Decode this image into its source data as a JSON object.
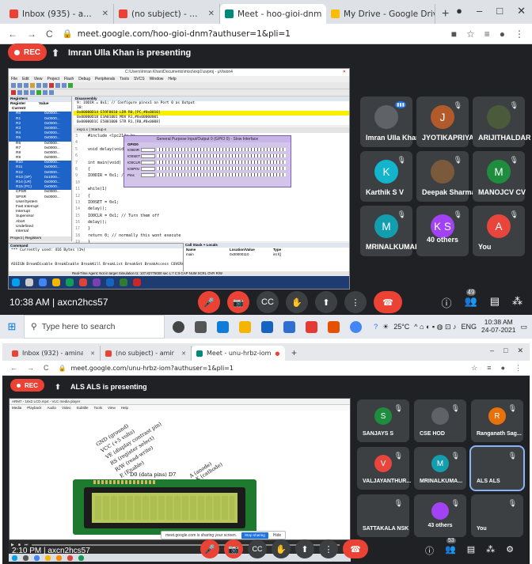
{
  "shot1": {
    "tabs": [
      {
        "label": "Inbox (935) - aminacs.skitbr@gm",
        "color": "#ea4335",
        "glyph": "M"
      },
      {
        "label": "(no subject) - aminacse@skit.org",
        "color": "#ea4335",
        "glyph": "M"
      },
      {
        "label": "Meet - hoo-gioi-dnm",
        "color": "#00897b",
        "glyph": "▶",
        "active": true
      },
      {
        "label": "My Drive - Google Drive",
        "color": "#fbbc04",
        "glyph": "▲"
      }
    ],
    "url": "meet.google.com/hoo-gioi-dnm?authuser=1&pli=1",
    "rec_label": "REC",
    "presenting_text": "Imran Ulla Khan is presenting",
    "ide": {
      "title": "C:\\Users\\Imran Khan\\Documents\\misc\\exp1\\uvproj - μVision4",
      "menu": [
        "File",
        "Edit",
        "View",
        "Project",
        "Flash",
        "Debug",
        "Peripherals",
        "Tools",
        "SVCS",
        "Window",
        "Help"
      ],
      "reg_header": "Registers",
      "reg_cols": [
        "Register",
        "Value"
      ],
      "reg_current": "Current",
      "registers": [
        {
          "name": "R0",
          "value": "0x0000..."
        },
        {
          "name": "R1",
          "value": "0x0000..."
        },
        {
          "name": "R2",
          "value": "0x0000..."
        },
        {
          "name": "R3",
          "value": "0x0000..."
        },
        {
          "name": "R4",
          "value": "0x0000..."
        },
        {
          "name": "R5",
          "value": "0x0000..."
        },
        {
          "name": "R6",
          "value": "0x0000..."
        },
        {
          "name": "R7",
          "value": "0x0000..."
        },
        {
          "name": "R8",
          "value": "0x0000..."
        },
        {
          "name": "R9",
          "value": "0x0000..."
        },
        {
          "name": "R10",
          "value": "0x0000..."
        },
        {
          "name": "R11",
          "value": "0x0000..."
        },
        {
          "name": "R12",
          "value": "0x0000..."
        },
        {
          "name": "R13 (SP)",
          "value": "0x1000..."
        },
        {
          "name": "R14 (LR)",
          "value": "0x0000..."
        },
        {
          "name": "R15 (PC)",
          "value": "0x0000..."
        },
        {
          "name": "CPSR",
          "value": "0x0000..."
        },
        {
          "name": "SPSR",
          "value": "0x0000..."
        },
        {
          "name": "User/System",
          "value": ""
        },
        {
          "name": "Fast Interrupt",
          "value": ""
        },
        {
          "name": "Interrupt",
          "value": ""
        },
        {
          "name": "Supervisor",
          "value": ""
        },
        {
          "name": "Abort",
          "value": ""
        },
        {
          "name": "Undefined",
          "value": ""
        },
        {
          "name": "Internal",
          "value": ""
        }
      ],
      "reg_tabs": "Project | Registers",
      "disasm_header": "Disassembly",
      "disasm": [
        "    9:      IODIR = 0x1;  // Configure pinsx1 on Port 0 as Output",
        "   10:",
        "0x00000D14  E59F0010  LDR     R0,[PC,#0x0010]",
        "0x00000D18  E3A01001  MOV     R1,#0x00000001",
        "0x00000D1C  E5801008  STR     R1,[R0,#0x0008]"
      ],
      "code_tabs": "exp1.c | Startup.s",
      "code": [
        {
          "n": "3",
          "t": "#include <lpc214x.h>"
        },
        {
          "n": "4",
          "t": ""
        },
        {
          "n": "5",
          "t": "void delay(void);"
        },
        {
          "n": "6",
          "t": ""
        },
        {
          "n": "7",
          "t": "int main(void)"
        },
        {
          "n": "8",
          "t": "{"
        },
        {
          "n": "9",
          "t": "  IO0DIR = 0x1; //"
        },
        {
          "n": "10",
          "t": ""
        },
        {
          "n": "11",
          "t": "  while(1)"
        },
        {
          "n": "12",
          "t": "  {"
        },
        {
          "n": "13",
          "t": "    IO0SET = 0x1;"
        },
        {
          "n": "14",
          "t": "    delay();"
        },
        {
          "n": "15",
          "t": "    IO0CLR = 0x1; // Turn them off"
        },
        {
          "n": "16",
          "t": "    delay();"
        },
        {
          "n": "17",
          "t": "  }"
        },
        {
          "n": "18",
          "t": "  return 0; // normally this wont execute"
        },
        {
          "n": "19",
          "t": "}"
        },
        {
          "n": "20",
          "t": ""
        },
        {
          "n": "21",
          "t": "void delay(void)"
        },
        {
          "n": "22",
          "t": "{"
        },
        {
          "n": "23",
          "t": "  int i = 0;"
        }
      ],
      "gpio": {
        "title": "General Purpose Input/Output 0 (GPIO 0) - Slow Interface",
        "group": "GPIO0",
        "rows": [
          {
            "label": "IO0DIR",
            "value": "0x00000001"
          },
          {
            "label": "IO0SET",
            "value": "0x00000000"
          },
          {
            "label": "IO0CLR",
            "value": "0x00000000"
          },
          {
            "label": "IO0PIN",
            "value": "0x5FFFFFFF"
          },
          {
            "label": "Pins",
            "value": "0x5FFFFFFF"
          }
        ]
      },
      "cmd_header": "Command",
      "cmd_lines": [
        "*** Currently used: 416 Bytes (1%)",
        "",
        "",
        "ASSIGN BreakDisable BreakEnable BreakKill BreakList BreakSet BreakAccess COVERAGE"
      ],
      "callstack_header": "Call Stack + Locals",
      "callstack_cols": [
        "Name",
        "Location/Value",
        "Type"
      ],
      "callstack_rows": [
        {
          "name": "main",
          "loc": "0x00000110",
          "type": "int f()"
        }
      ],
      "status": "Real-Time Agent: Not in target   Simulation   t1: 107.82775000 sec   L:7 C:9   CAP  NUM  SCRL  OVR  R/W"
    },
    "tiles": [
      {
        "name": "Imran Ulla Khan",
        "initial": "",
        "color": "#5f6368",
        "speaking": true
      },
      {
        "name": "JYOTIKAPRIYA...",
        "initial": "J",
        "color": "#b35a2b"
      },
      {
        "name": "ARIJITHALDAR ...",
        "initial": "",
        "color": "#4a5a3a"
      },
      {
        "name": "Karthik S V",
        "initial": "K",
        "color": "#12b5cb"
      },
      {
        "name": "Deepak Sharma",
        "initial": "",
        "color": "#7a5a3a"
      },
      {
        "name": "MANOJCV CV",
        "initial": "M",
        "color": "#1e8e3e"
      },
      {
        "name": "MRINALKUMAR...",
        "initial": "M",
        "color": "#129eaf"
      },
      {
        "name": "40 others",
        "initial": "K S",
        "color": "#a142f4"
      },
      {
        "name": "You",
        "initial": "A",
        "color": "#e8453c"
      }
    ],
    "time_meeting": "10:38 AM  |  axcn2hcs57",
    "participant_count": "49",
    "taskbar": {
      "search_placeholder": "Type here to search",
      "weather": "25°C",
      "lang": "ENG",
      "time": "10:38 AM",
      "date": "24-07-2021"
    }
  },
  "shot2": {
    "tabs": [
      {
        "label": "Inbox (932) - aminacs.skitbr@gm",
        "color": "#ea4335",
        "glyph": "M"
      },
      {
        "label": "(no subject) - aminacse@skit.org",
        "color": "#ea4335",
        "glyph": "M"
      },
      {
        "label": "Meet - unu-hrbz-iom",
        "color": "#00897b",
        "glyph": "▶",
        "active": true
      }
    ],
    "url": "meet.google.com/unu-hrbz-iom?authuser=1&pli=1",
    "rec_label": "REC",
    "presenting_text": "ALS ALS is presenting",
    "slide": {
      "title": "ARM7 - 16x2 LCD.mp4 - VLC media player",
      "menu": [
        "Media",
        "Playback",
        "Audio",
        "Video",
        "Subtitle",
        "Tools",
        "View",
        "Help"
      ],
      "pin_labels": [
        "GND (ground)",
        "VCC (+5 volts)",
        "VE (display contrast pin)",
        "RS (register select)",
        "R/W (read-write)",
        "E (Enable)",
        "D0   (data pins)  D7",
        "A (anode)",
        "K (cathode)"
      ],
      "notif_text": "meet.google.com is sharing your screen.",
      "notif_button": "Stop sharing",
      "notif_hide": "Hide"
    },
    "tiles": [
      {
        "name": "SANJAYS S",
        "initial": "S",
        "color": "#1e8e3e"
      },
      {
        "name": "CSE HOD",
        "initial": "",
        "color": "#5f6368"
      },
      {
        "name": "Ranganath Sag...",
        "initial": "R",
        "color": "#e8710a"
      },
      {
        "name": "VALJAYANTHUR...",
        "initial": "V",
        "color": "#e8453c"
      },
      {
        "name": "MRINALKUMA...",
        "initial": "M",
        "color": "#129eaf"
      },
      {
        "name": "ALS ALS",
        "initial": "",
        "color": "#3c4043",
        "selected": true
      },
      {
        "name": "SATTAKALA NSK",
        "initial": "",
        "color": "#3c4043"
      },
      {
        "name": "43 others",
        "initial": "",
        "color": "#a142f4"
      },
      {
        "name": "You",
        "initial": "",
        "color": "#3c4043"
      }
    ],
    "time_meeting": "2:10 PM  |  axcn2hcs57",
    "participant_count": "53"
  }
}
